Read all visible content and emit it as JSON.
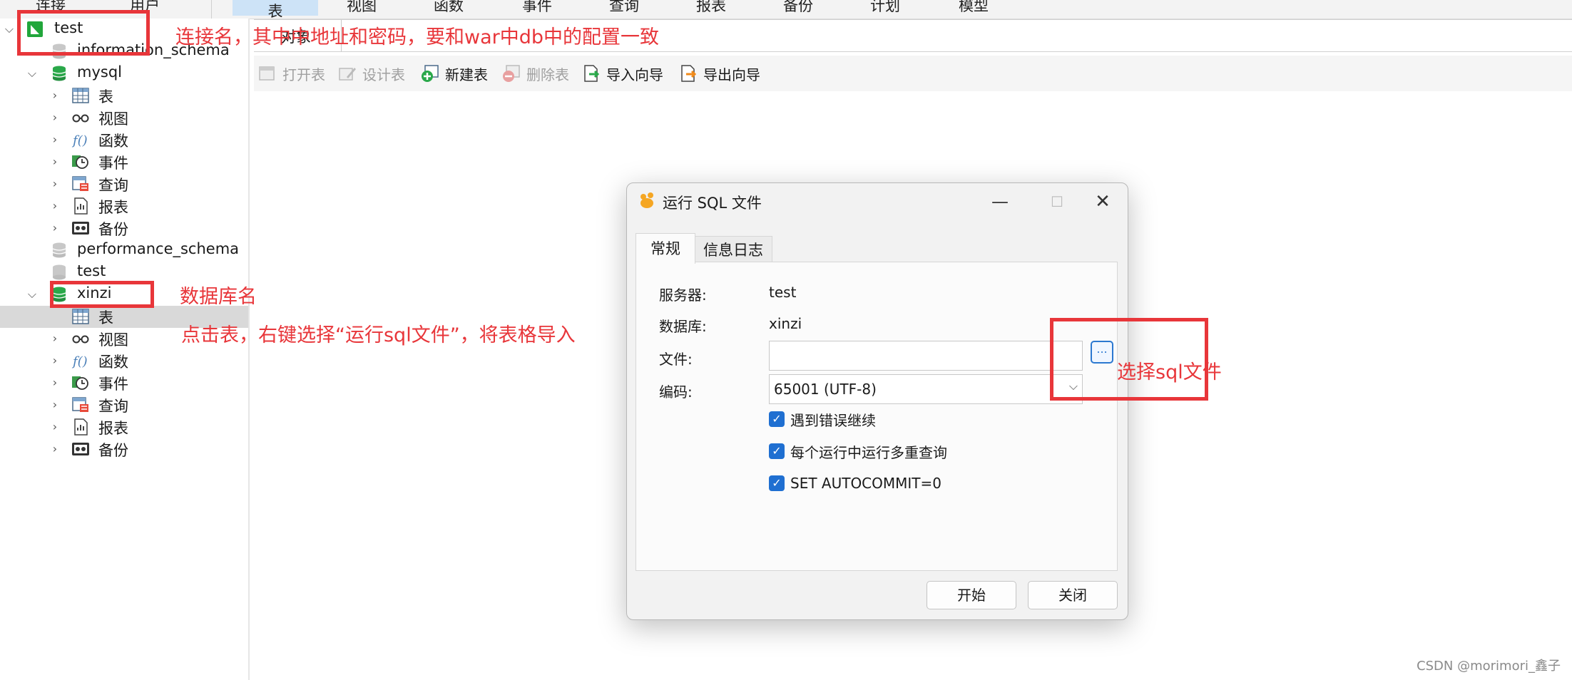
{
  "topbar": {
    "items": [
      {
        "label": "连接",
        "active": false
      },
      {
        "label": "用户",
        "active": false
      },
      {
        "label": "表",
        "active": true
      },
      {
        "label": "视图",
        "active": false
      },
      {
        "label": "函数",
        "active": false
      },
      {
        "label": "事件",
        "active": false
      },
      {
        "label": "查询",
        "active": false
      },
      {
        "label": "报表",
        "active": false
      },
      {
        "label": "备份",
        "active": false
      },
      {
        "label": "计划",
        "active": false
      },
      {
        "label": "模型",
        "active": false
      }
    ]
  },
  "tree": {
    "connection": "test",
    "databases": {
      "information_schema": "information_schema",
      "mysql": "mysql",
      "performance_schema": "performance_schema",
      "test": "test",
      "xinzi": "xinzi"
    },
    "objects": {
      "tables": "表",
      "views": "视图",
      "functions": "函数",
      "events": "事件",
      "queries": "查询",
      "reports": "报表",
      "backups": "备份"
    }
  },
  "objbar": {
    "label": "对象"
  },
  "toolbar": {
    "open_table": "打开表",
    "design_table": "设计表",
    "new_table": "新建表",
    "delete_table": "删除表",
    "import_wizard": "导入向导",
    "export_wizard": "导出向导"
  },
  "dialog": {
    "title": "运行 SQL 文件",
    "tabs": {
      "general": "常规",
      "info_log": "信息日志"
    },
    "labels": {
      "server": "服务器:",
      "database": "数据库:",
      "file": "文件:",
      "encoding": "编码:"
    },
    "values": {
      "server": "test",
      "database": "xinzi",
      "file": "",
      "encoding": "65001 (UTF-8)"
    },
    "browse": "...",
    "checkboxes": {
      "continue_on_error": "遇到错误继续",
      "multi_query": "每个运行中运行多重查询",
      "autocommit": "SET AUTOCOMMIT=0"
    },
    "buttons": {
      "start": "开始",
      "close": "关闭"
    }
  },
  "annotations": {
    "connection_note": "连接名，其中中地址和密码，要和war中db中的配置一致",
    "db_note": "数据库名",
    "table_note": "点击表，右键选择“运行sql文件”，将表格导入",
    "file_note": "选择sql文件"
  },
  "watermark": "CSDN @morimori_鑫子",
  "colors": {
    "annotation": "#e8363a",
    "accent": "#1f6fd1",
    "selected_row": "#d9d9d9"
  }
}
